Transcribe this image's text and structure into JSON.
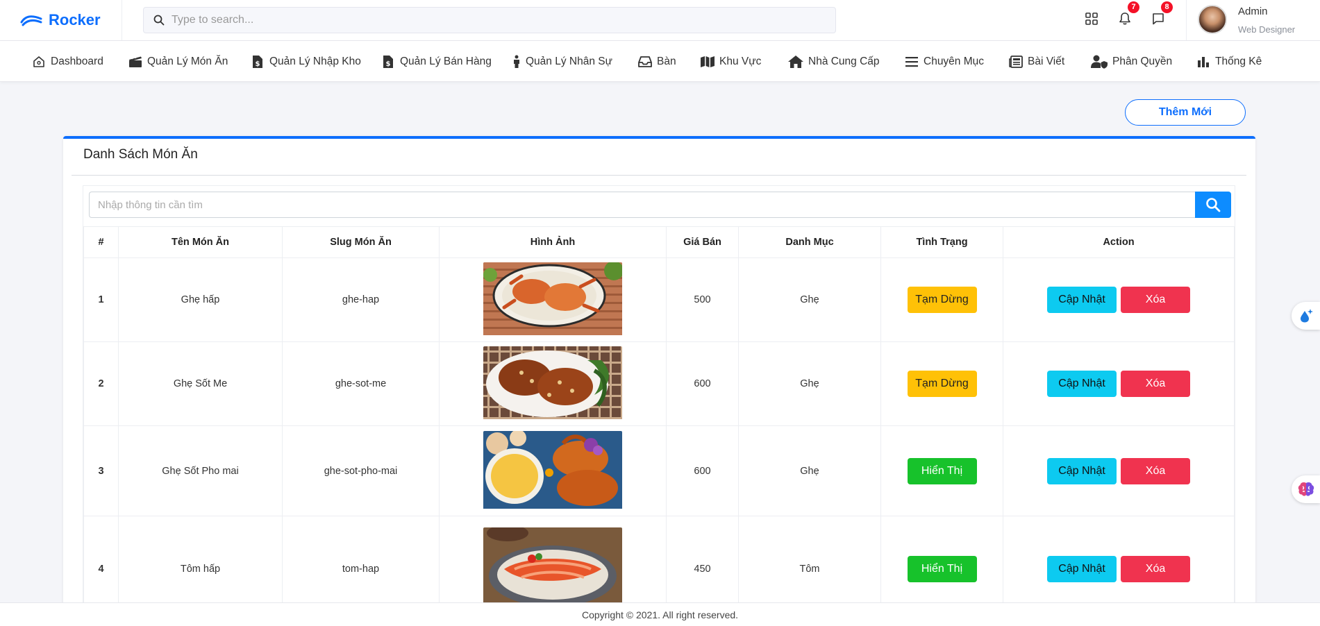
{
  "brand": {
    "name": "Rocker",
    "logo_icon": "wave-logo-icon",
    "color": "#0d6efd"
  },
  "search": {
    "placeholder": "Type to search..."
  },
  "header": {
    "apps_icon": "grid-icon",
    "notifications": {
      "icon": "bell-icon",
      "count": "7"
    },
    "messages": {
      "icon": "chat-icon",
      "count": "8"
    },
    "user": {
      "name": "Admin",
      "role": "Web Designer"
    }
  },
  "nav": [
    {
      "label": "Dashboard",
      "icon": "home-icon"
    },
    {
      "label": "Quản Lý Món Ăn",
      "icon": "clapper-icon"
    },
    {
      "label": "Quản Lý Nhập Kho",
      "icon": "invoice-dollar-icon"
    },
    {
      "label": "Quản Lý Bán Hàng",
      "icon": "invoice-dollar-icon"
    },
    {
      "label": "Quản Lý Nhân Sự",
      "icon": "person-icon"
    },
    {
      "label": "Bàn",
      "icon": "inbox-icon"
    },
    {
      "label": "Khu Vực",
      "icon": "map-icon"
    },
    {
      "label": "Nhà Cung Cấp",
      "icon": "house-icon"
    },
    {
      "label": "Chuyên Mục",
      "icon": "list-icon"
    },
    {
      "label": "Bài Viết",
      "icon": "newspaper-icon"
    },
    {
      "label": "Phân Quyền",
      "icon": "user-shield-icon"
    },
    {
      "label": "Thống Kê",
      "icon": "bar-chart-icon"
    }
  ],
  "main": {
    "add_button": "Thêm Mới",
    "card_title": "Danh Sách Món Ăn",
    "table_search_placeholder": "Nhập thông tin cần tìm",
    "columns": [
      "#",
      "Tên Món Ăn",
      "Slug Món Ăn",
      "Hình Ảnh",
      "Giá Bán",
      "Danh Mục",
      "Tình Trạng",
      "Action"
    ],
    "rows": [
      {
        "idx": "1",
        "name": "Ghẹ hấp",
        "slug": "ghe-hap",
        "price": "500",
        "category": "Ghẹ",
        "status": "Tạm Dừng",
        "status_type": "pause",
        "update": "Cập Nhật",
        "delete": "Xóa"
      },
      {
        "idx": "2",
        "name": "Ghẹ Sốt Me",
        "slug": "ghe-sot-me",
        "price": "600",
        "category": "Ghẹ",
        "status": "Tạm Dừng",
        "status_type": "pause",
        "update": "Cập Nhật",
        "delete": "Xóa"
      },
      {
        "idx": "3",
        "name": "Ghẹ Sốt Pho mai",
        "slug": "ghe-sot-pho-mai",
        "price": "600",
        "category": "Ghẹ",
        "status": "Hiển Thị",
        "status_type": "show",
        "update": "Cập Nhật",
        "delete": "Xóa"
      },
      {
        "idx": "4",
        "name": "Tôm hấp",
        "slug": "tom-hap",
        "price": "450",
        "category": "Tôm",
        "status": "Hiển Thị",
        "status_type": "show",
        "update": "Cập Nhật",
        "delete": "Xóa"
      }
    ]
  },
  "footer": {
    "text": "Copyright © 2021. All right reserved."
  },
  "floating": [
    {
      "icon": "droplet-sparkle-icon"
    },
    {
      "icon": "brain-icon"
    }
  ]
}
